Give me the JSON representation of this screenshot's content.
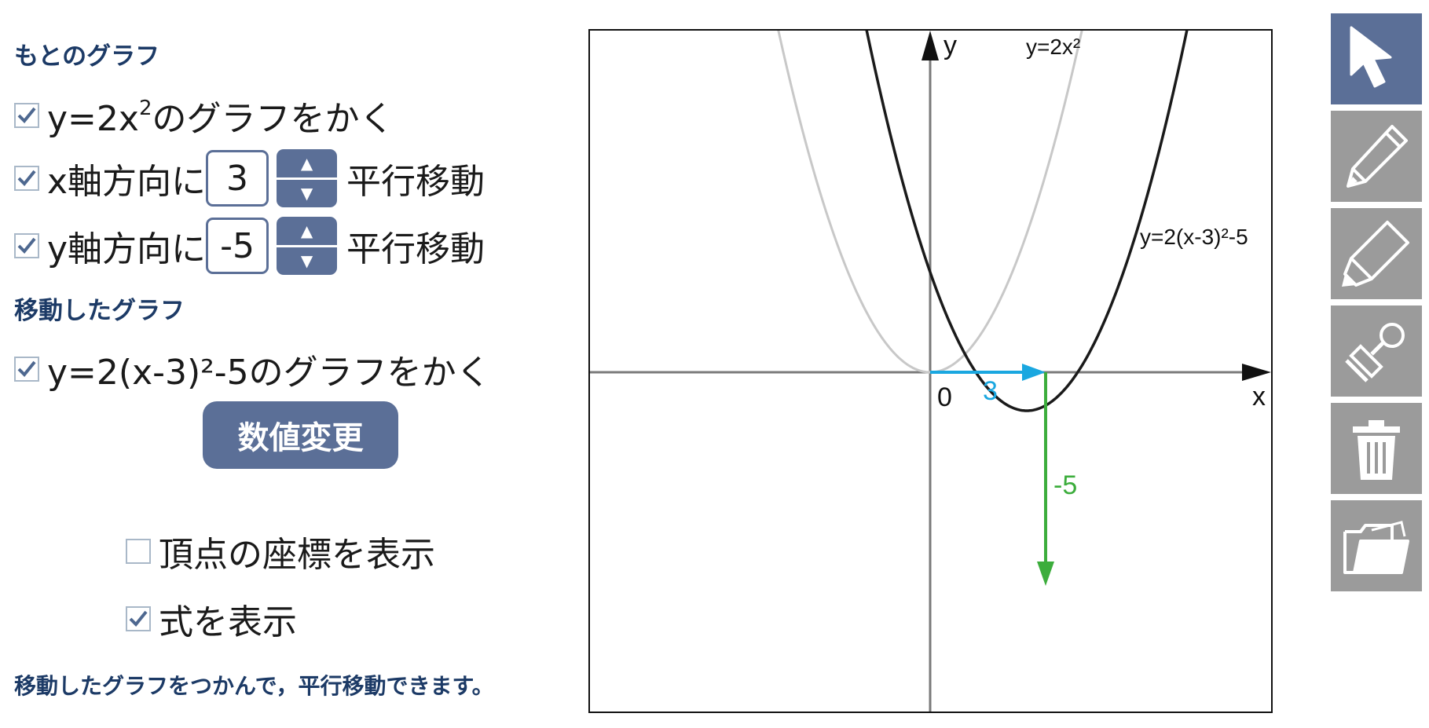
{
  "original": {
    "heading": "もとのグラフ",
    "draw_label_prefix": "y=2x",
    "draw_label_exp": "2",
    "draw_label_suffix": "のグラフをかく",
    "draw_checked": true
  },
  "shift_x": {
    "label": "x軸方向に",
    "value": "3",
    "suffix": "平行移動",
    "checked": true
  },
  "shift_y": {
    "label": "y軸方向に",
    "value": "-5",
    "suffix": "平行移動",
    "checked": true
  },
  "moved": {
    "heading": "移動したグラフ",
    "draw_label": "y=2(x-3)²-5のグラフをかく",
    "draw_checked": true
  },
  "apply_button": "数値変更",
  "options": {
    "vertex_label": "頂点の座標を表示",
    "vertex_checked": false,
    "formula_label": "式を表示",
    "formula_checked": true
  },
  "note": "移動したグラフをつかんで，平行移動できます。",
  "graph": {
    "x_axis_label": "x",
    "y_axis_label": "y",
    "origin_label": "0",
    "original_formula": "y=2x²",
    "moved_formula": "y=2(x-3)²-5",
    "shift_x_label": "3",
    "shift_y_label": "-5",
    "colors": {
      "original_curve": "#c8c8c8",
      "moved_curve": "#1a1a1a",
      "x_arrow": "#1aa7e0",
      "y_arrow": "#3cad3c",
      "axis": "#7a7a7a"
    }
  },
  "toolbar": [
    {
      "name": "pointer-icon",
      "active": true
    },
    {
      "name": "pencil-icon",
      "active": false
    },
    {
      "name": "marker-icon",
      "active": false
    },
    {
      "name": "stamp-icon",
      "active": false
    },
    {
      "name": "trash-icon",
      "active": false
    },
    {
      "name": "folder-icon",
      "active": false
    }
  ]
}
